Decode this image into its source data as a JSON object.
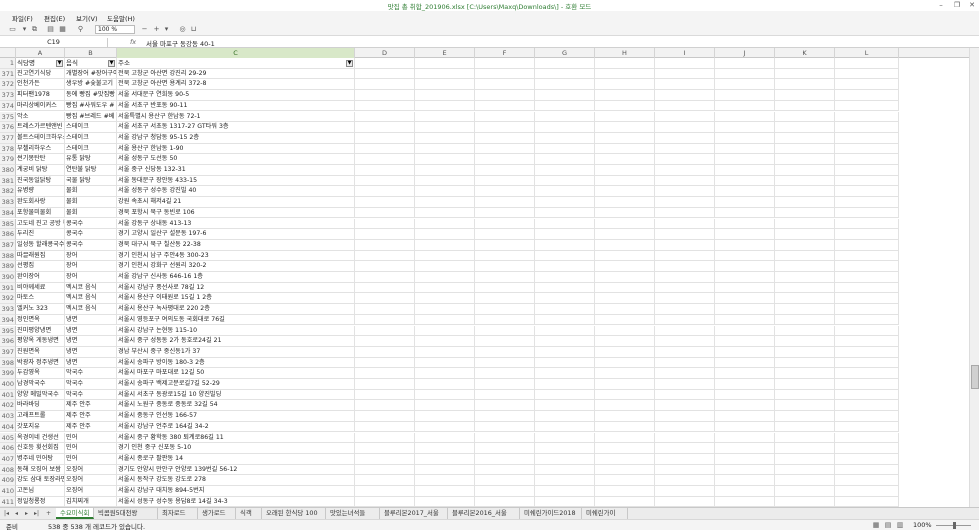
{
  "window": {
    "title": "맛집 총 취합_201906.xlsx [C:\\Users\\Maxq\\Downloads\\] - 호환 모드"
  },
  "menu": [
    "파일(F)",
    "편집(E)",
    "보기(V)",
    "도움말(H)"
  ],
  "toolbar": {
    "zoom": "100 %"
  },
  "formula_bar": {
    "cell": "C19",
    "fx": "fx",
    "value": "서울 마포구 동강동 40-1"
  },
  "columns": [
    "A",
    "B",
    "C",
    "D",
    "E",
    "F",
    "G",
    "H",
    "I",
    "J",
    "K",
    "L"
  ],
  "selected_column": "C",
  "header_row": {
    "name": "식당명",
    "food": "음식",
    "addr": "주소"
  },
  "rows": [
    {
      "n": "371",
      "a": "진고연기식당",
      "b": "개별장어 #장어구이",
      "c": "전북 고창군 아산면 강진리 29-29"
    },
    {
      "n": "372",
      "a": "인천가든",
      "b": "생우방 #숯불고기",
      "c": "전북 고창군 아산면 용계리 372-8"
    },
    {
      "n": "373",
      "a": "피터팬1978",
      "b": "동에 빵집 #맛집빵",
      "c": "서울 서대문구 연희동 90-5"
    },
    {
      "n": "374",
      "a": "마리상베이커스",
      "b": "빵집 #사워도우 #",
      "c": "서울 서초구 반포동 90-11"
    },
    {
      "n": "375",
      "a": "악소",
      "b": "빵집 #브레드 #베",
      "c": "서울특별시 용산구 한남동 72-1"
    },
    {
      "n": "376",
      "a": "트레스가르텐앤빈",
      "b": "스테이크",
      "c": "서울 서초구 서초동 1317-27 GT타워 3층"
    },
    {
      "n": "377",
      "a": "볼트스테이크하우스",
      "b": "스테이크",
      "c": "서울 강남구 청담동 95-15 2층"
    },
    {
      "n": "378",
      "a": "부첼리하우스",
      "b": "스테이크",
      "c": "서울 용산구 한남동 1-90"
    },
    {
      "n": "379",
      "a": "썬기몽탄탄",
      "b": "유통 닭탕",
      "c": "서울 성동구 도선동 50"
    },
    {
      "n": "380",
      "a": "계궁비 닭탕",
      "b": "연탄불 닭탕",
      "c": "서울 중구 신당동 132-31"
    },
    {
      "n": "381",
      "a": "진국동일닭탕",
      "b": "국물 닭탕",
      "c": "서울 동대문구 장안동 433-15"
    },
    {
      "n": "382",
      "a": "유병량",
      "b": "물회",
      "c": "서울 성동구 성수동 강진빌 40"
    },
    {
      "n": "383",
      "a": "완도회사랑",
      "b": "물회",
      "c": "강원 속초시 해저4길 21"
    },
    {
      "n": "384",
      "a": "포항물미물회",
      "b": "물회",
      "c": "경북 포항시 북구 동빈로 106"
    },
    {
      "n": "385",
      "a": "고도네 진고 공방 특",
      "b": "콩국수",
      "c": "서울 강동구 상내동 413-13"
    },
    {
      "n": "386",
      "a": "두리진",
      "b": "콩국수",
      "c": "경기 고양시 일산구 설문동 197-6"
    },
    {
      "n": "387",
      "a": "일성동 할래콩국수",
      "b": "콩국수",
      "c": "경북 대구시 북구 칠산동 22-38"
    },
    {
      "n": "388",
      "a": "따끌래원집",
      "b": "장어",
      "c": "경기 인천시 남구 주안4동 300-23"
    },
    {
      "n": "389",
      "a": "선평집",
      "b": "장어",
      "c": "경기 인천시 강화구 선원리 320-2"
    },
    {
      "n": "390",
      "a": "완이장어",
      "b": "장어",
      "c": "서울 강남구 신사동 646-16 1층"
    },
    {
      "n": "391",
      "a": "비야께세료",
      "b": "멕시코 음식",
      "c": "서울시 강남구 풍선사로 78길 12"
    },
    {
      "n": "392",
      "a": "마토스",
      "b": "멕시코 음식",
      "c": "서울시 용산구 이태원로 15길 1 2층"
    },
    {
      "n": "393",
      "a": "엘커노 323",
      "b": "멕시코 음식",
      "c": "서울시 용산구 녹사평대로 220 2층"
    },
    {
      "n": "394",
      "a": "정인면옥",
      "b": "냉면",
      "c": "서울시 영등포구 여의도동 국회대로 76길"
    },
    {
      "n": "395",
      "a": "진미평양냉면",
      "b": "냉면",
      "c": "서울시 강남구 논현동 115-10"
    },
    {
      "n": "396",
      "a": "평양옥 게동냉면",
      "b": "냉면",
      "c": "서울시 중구 성동동 2가 동호로24길 21"
    },
    {
      "n": "397",
      "a": "진원면옥",
      "b": "냉면",
      "c": "경남 부산시 중구 중신동1가 37"
    },
    {
      "n": "398",
      "a": "박광자 정주냉면",
      "b": "냉면",
      "c": "서울시 송파구 방이동 180-3 2층"
    },
    {
      "n": "399",
      "a": "두감영옥",
      "b": "막국수",
      "c": "서울시 마포구 마포대로 12길 50"
    },
    {
      "n": "400",
      "a": "남경막국수",
      "b": "막국수",
      "c": "서울시 송파구 백제고분로길7길 52-29"
    },
    {
      "n": "401",
      "a": "양양 메밀막국수",
      "b": "막국수",
      "c": "서울시 서초구 동광로15길 10 양진빌딩"
    },
    {
      "n": "402",
      "a": "바라바딩",
      "b": "제주 안주",
      "c": "서울시 노원구 중동로 중동로 32길 54"
    },
    {
      "n": "403",
      "a": "고래프트롤",
      "b": "제주 안주",
      "c": "서울시 중동구 인선동 166-57"
    },
    {
      "n": "404",
      "a": "갓포지유",
      "b": "제주 안주",
      "c": "서울시 강남구 언주로 164길 34-2"
    },
    {
      "n": "405",
      "a": "옥경이네 건생선",
      "b": "민어",
      "c": "서울시 중구 황학동 380 퇴계로86길 11"
    },
    {
      "n": "406",
      "a": "신호등 횟선회집",
      "b": "민어",
      "c": "경기 인천 중구 신포동 5-10"
    },
    {
      "n": "407",
      "a": "병주네 민어탕",
      "b": "민어",
      "c": "서울시 종로구 팔판동 14"
    },
    {
      "n": "408",
      "a": "동해 오징어 보쌈",
      "b": "오징어",
      "c": "경기도 안양시 만안구 안양로 139번길 56-12"
    },
    {
      "n": "409",
      "a": "강도 삼대 토장라면",
      "b": "오징어",
      "c": "서울시 동작구 강도동 강도로 278"
    },
    {
      "n": "410",
      "a": "고돈님",
      "b": "오징어",
      "c": "서울시 강남구 대치동 894-5번지"
    },
    {
      "n": "411",
      "a": "정일청룡정",
      "b": "김치찌개",
      "c": "서울시 성동구 성수동 용답8로 14길 34-3"
    }
  ],
  "tabs": [
    "수요미식회",
    "빅콤원5대천왕",
    "최자로드",
    "생가로드",
    "식객",
    "오래된 한식당 100",
    "맛있는녀석들",
    "블루리본2017_서울",
    "블루리본2016_서울",
    "미쉐린가이드2018",
    "미쉐린가이"
  ],
  "active_tab": 0,
  "status": {
    "ready": "준비",
    "records": "538 중 538 개 레코드가 있습니다.",
    "zoom": "100%"
  }
}
